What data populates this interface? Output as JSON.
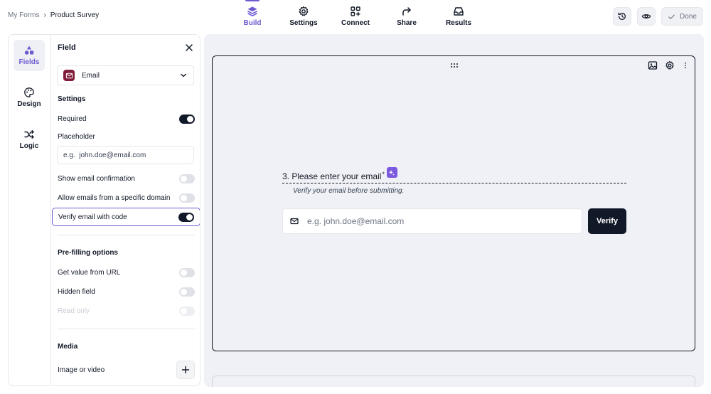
{
  "breadcrumb": {
    "parent": "My Forms",
    "separator": "›",
    "current": "Product Survey"
  },
  "nav": {
    "items": [
      {
        "label": "Build",
        "icon": "layers-icon",
        "active": true
      },
      {
        "label": "Settings",
        "icon": "gear-icon",
        "active": false
      },
      {
        "label": "Connect",
        "icon": "grid-plus-icon",
        "active": false
      },
      {
        "label": "Share",
        "icon": "share-arrow-icon",
        "active": false
      },
      {
        "label": "Results",
        "icon": "inbox-icon",
        "active": false
      }
    ],
    "accent": "#6d5bd0"
  },
  "toolbar": {
    "history_icon": "history-icon",
    "preview_icon": "eye-icon",
    "done_label": "Done"
  },
  "sidebar": {
    "tabs": [
      {
        "label": "Fields",
        "icon": "shapes-icon",
        "active": true
      },
      {
        "label": "Design",
        "icon": "palette-icon",
        "active": false
      },
      {
        "label": "Logic",
        "icon": "shuffle-icon",
        "active": false
      }
    ]
  },
  "field_panel": {
    "title": "Field",
    "field_type": "Email",
    "settings_title": "Settings",
    "required_label": "Required",
    "required_on": true,
    "placeholder_label": "Placeholder",
    "placeholder_value": "e.g.  john.doe@email.com",
    "show_confirmation_label": "Show email confirmation",
    "allow_specific_domain_label": "Allow emails from a specific domain",
    "verify_label": "Verify email with code",
    "verify_on": true,
    "prefill_title": "Pre-filling options",
    "url_value_label": "Get value from URL",
    "hidden_field_label": "Hidden field",
    "read_only_label": "Read only",
    "media_title": "Media",
    "image_video_label": "Image or video"
  },
  "question": {
    "title": "3. Please enter your email",
    "required_marker": "*",
    "help_text": "Verify your email before submitting.",
    "input_placeholder": "e.g.  john.doe@email.com",
    "verify_button": "Verify",
    "magic_color": "#7c5ae0"
  }
}
